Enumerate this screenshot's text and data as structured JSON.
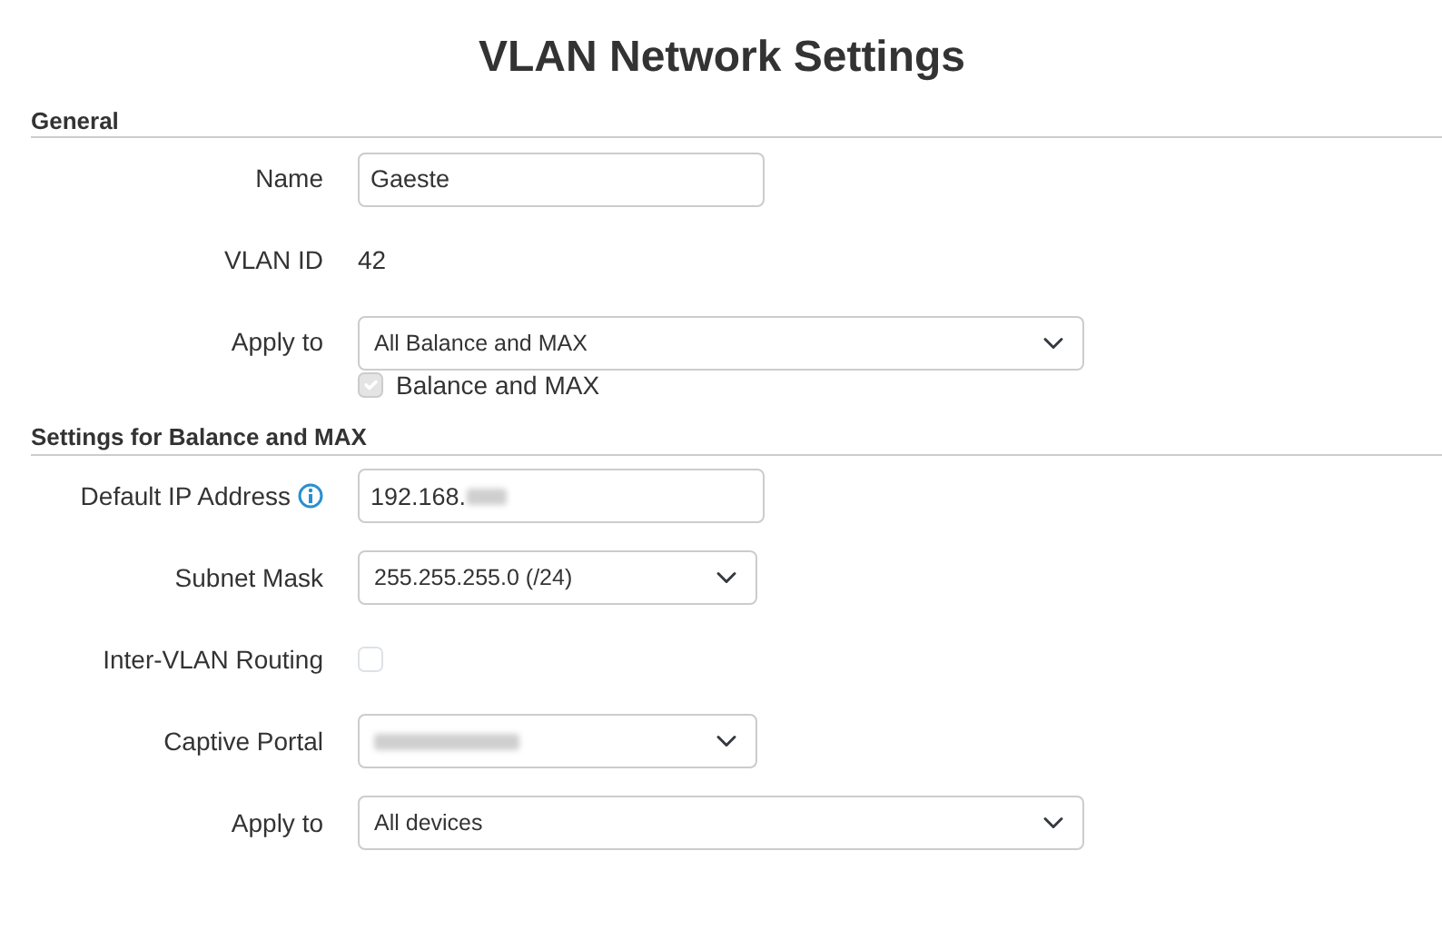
{
  "title": "VLAN Network Settings",
  "sections": [
    {
      "heading": "General",
      "fields": [
        {
          "kind": "text",
          "label": "Name",
          "value": "Gaeste"
        },
        {
          "kind": "static",
          "label": "VLAN ID",
          "value": "42"
        },
        {
          "kind": "wide-select",
          "label": "Apply to",
          "value": "All Balance and MAX",
          "options": [
            {
              "label": "Balance and MAX",
              "checked": true,
              "disabled": true
            }
          ]
        }
      ]
    },
    {
      "heading": "Settings for Balance and MAX",
      "fields": [
        {
          "kind": "text",
          "label": "Default IP Address",
          "info": true,
          "value": "192.168.",
          "blurred_tail": true
        },
        {
          "kind": "select",
          "label": "Subnet Mask",
          "value": "255.255.255.0 (/24)"
        },
        {
          "kind": "checkbox",
          "label": "Inter-VLAN Routing",
          "checked": false
        },
        {
          "kind": "select",
          "label": "Captive Portal",
          "blurred": true
        },
        {
          "kind": "wide-select",
          "label": "Apply to",
          "value": "All devices"
        }
      ]
    }
  ]
}
